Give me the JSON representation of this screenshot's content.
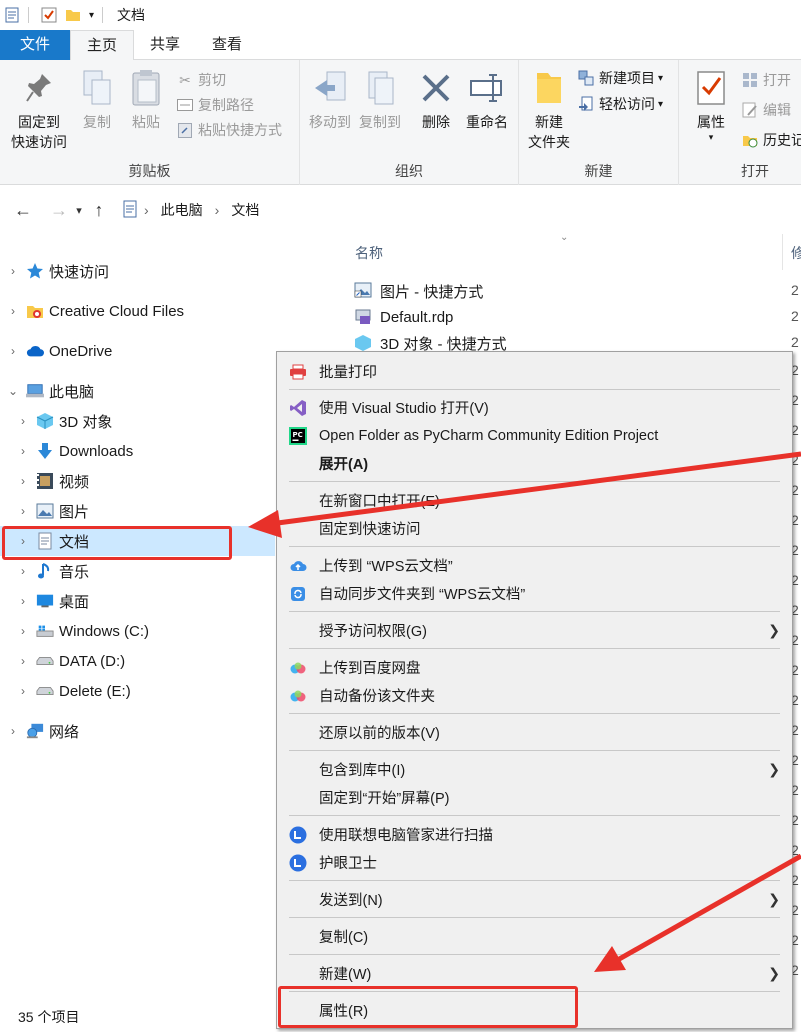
{
  "window": {
    "title": "文档"
  },
  "ribbon_tabs": [
    "文件",
    "主页",
    "共享",
    "查看"
  ],
  "ribbon": {
    "clipboard": {
      "label": "剪贴板",
      "pin_label_1": "固定到",
      "pin_label_2": "快速访问",
      "copy": "复制",
      "paste": "粘贴",
      "cut": "剪切",
      "copy_path": "复制路径",
      "paste_shortcut": "粘贴快捷方式"
    },
    "organize": {
      "label": "组织",
      "move_to": "移动到",
      "copy_to": "复制到",
      "delete": "删除",
      "rename": "重命名"
    },
    "new": {
      "label": "新建",
      "new_folder_1": "新建",
      "new_folder_2": "文件夹",
      "new_item": "新建项目",
      "easy_access": "轻松访问"
    },
    "open": {
      "label": "打开",
      "properties": "属性",
      "open": "打开",
      "edit": "编辑",
      "history": "历史记"
    }
  },
  "address": {
    "crumbs": [
      "此电脑",
      "文档"
    ]
  },
  "nav": {
    "items": [
      {
        "label": "快速访问",
        "icon": "star-icon"
      },
      {
        "label": "Creative Cloud Files",
        "icon": "creative-cloud-icon"
      },
      {
        "label": "OneDrive",
        "icon": "cloud-icon"
      },
      {
        "label": "此电脑",
        "icon": "computer-icon"
      },
      {
        "label": "3D 对象",
        "icon": "cube-icon"
      },
      {
        "label": "Downloads",
        "icon": "download-icon"
      },
      {
        "label": "视频",
        "icon": "video-icon"
      },
      {
        "label": "图片",
        "icon": "picture-icon"
      },
      {
        "label": "文档",
        "icon": "document-icon"
      },
      {
        "label": "音乐",
        "icon": "music-icon"
      },
      {
        "label": "桌面",
        "icon": "desktop-icon"
      },
      {
        "label": "Windows (C:)",
        "icon": "windows-drive-icon"
      },
      {
        "label": "DATA (D:)",
        "icon": "drive-icon"
      },
      {
        "label": "Delete (E:)",
        "icon": "drive-icon"
      },
      {
        "label": "网络",
        "icon": "network-icon"
      }
    ]
  },
  "filelist": {
    "col_name": "名称",
    "col_modified": "修",
    "files": [
      {
        "name": "图片 - 快捷方式",
        "date": "2"
      },
      {
        "name": "Default.rdp",
        "date": "2"
      },
      {
        "name": "3D 对象 - 快捷方式",
        "date": "2"
      }
    ],
    "date_fragments": [
      "2",
      "2",
      "2",
      "2",
      "2",
      "2",
      "2",
      "2",
      "2",
      "2",
      "2",
      "2",
      "2",
      "2",
      "2",
      "2",
      "2",
      "2",
      "2",
      "2",
      "2",
      "2",
      "2",
      "2"
    ]
  },
  "status": {
    "count": "35 个项目"
  },
  "context_menu": {
    "items": [
      {
        "label": "批量打印",
        "icon": "printer-icon"
      },
      {
        "label": "使用 Visual Studio 打开(V)",
        "icon": "visual-studio-icon"
      },
      {
        "label": "Open Folder as PyCharm Community Edition Project",
        "icon": "pycharm-icon"
      },
      {
        "label": "展开(A)",
        "bold": true
      },
      {
        "label": "在新窗口中打开(E)"
      },
      {
        "label": "固定到快速访问"
      },
      {
        "label": "上传到 “WPS云文档”",
        "icon": "wps-upload-icon"
      },
      {
        "label": "自动同步文件夹到 “WPS云文档”",
        "icon": "wps-sync-icon"
      },
      {
        "label": "授予访问权限(G)",
        "submenu": true
      },
      {
        "label": "上传到百度网盘",
        "icon": "baidu-icon"
      },
      {
        "label": "自动备份该文件夹",
        "icon": "baidu-icon"
      },
      {
        "label": "还原以前的版本(V)"
      },
      {
        "label": "包含到库中(I)",
        "submenu": true
      },
      {
        "label": "固定到“开始”屏幕(P)"
      },
      {
        "label": "使用联想电脑管家进行扫描",
        "icon": "lenovo-icon"
      },
      {
        "label": "护眼卫士",
        "icon": "lenovo-icon"
      },
      {
        "label": "发送到(N)",
        "submenu": true
      },
      {
        "label": "复制(C)"
      },
      {
        "label": "新建(W)",
        "submenu": true
      },
      {
        "label": "属性(R)"
      }
    ]
  },
  "colors": {
    "accent": "#1979ca",
    "selection": "#cce8ff",
    "annotation": "#e8312a",
    "menu_bg": "#f0f0f0"
  }
}
